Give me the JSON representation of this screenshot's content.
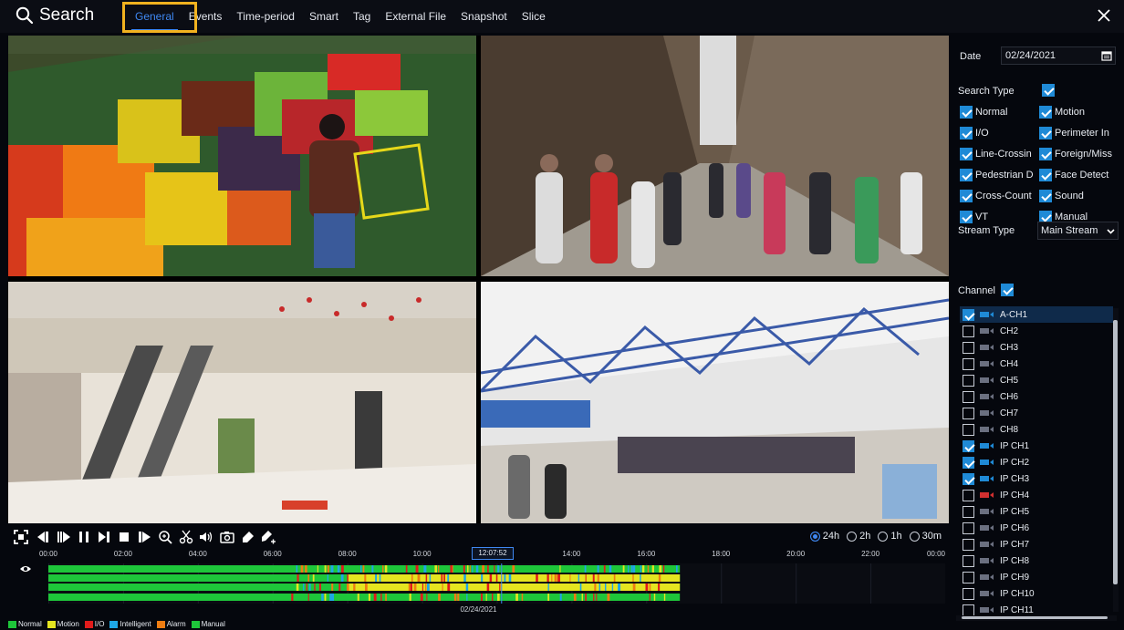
{
  "app": {
    "title": "Search",
    "tabs": [
      {
        "label": "General",
        "active": true
      },
      {
        "label": "Events",
        "active": false
      },
      {
        "label": "Time-period",
        "active": false
      },
      {
        "label": "Smart",
        "active": false
      },
      {
        "label": "Tag",
        "active": false
      },
      {
        "label": "External File",
        "active": false
      },
      {
        "label": "Snapshot",
        "active": false
      },
      {
        "label": "Slice",
        "active": false
      }
    ],
    "accent_color": "#3f88f2",
    "highlight_color": "#f2b21f",
    "close_icon": "close-icon"
  },
  "video_tiles": [
    {
      "scene": "grocery-produce"
    },
    {
      "scene": "pedestrian-street"
    },
    {
      "scene": "shopping-mall-escalator"
    },
    {
      "scene": "airport-terminal"
    }
  ],
  "playback": {
    "controls": [
      "fullscreen-icon",
      "rewind-icon",
      "step-forward-icon",
      "pause-icon",
      "next-frame-icon",
      "stop-icon",
      "fast-forward-icon",
      "zoom-icon",
      "clip-icon",
      "audio-icon",
      "snapshot-icon",
      "tag-icon",
      "add-tag-icon"
    ],
    "zoom_options": [
      {
        "label": "24h",
        "selected": true
      },
      {
        "label": "2h",
        "selected": false
      },
      {
        "label": "1h",
        "selected": false
      },
      {
        "label": "30m",
        "selected": false
      }
    ]
  },
  "timeline": {
    "ticks": [
      "00:00",
      "02:00",
      "04:00",
      "06:00",
      "08:00",
      "10:00",
      "12:00",
      "14:00",
      "16:00",
      "18:00",
      "20:00",
      "22:00",
      "00:00"
    ],
    "current_time": "12:07:52",
    "date": "02/24/2021",
    "recorded_until_hour": 16.9,
    "colors": {
      "normal": "#1ec63a",
      "motion": "#e5e520",
      "io": "#e01b1b",
      "intelligent": "#1ea7e6",
      "alarm": "#ef7d12",
      "manual": "#1ec63a"
    }
  },
  "legend": [
    {
      "label": "Normal",
      "color": "#1ec63a"
    },
    {
      "label": "Motion",
      "color": "#e5e520"
    },
    {
      "label": "I/O",
      "color": "#e01b1b"
    },
    {
      "label": "Intelligent",
      "color": "#1ea7e6"
    },
    {
      "label": "Alarm",
      "color": "#ef7d12"
    },
    {
      "label": "Manual",
      "color": "#1ec63a"
    }
  ],
  "panel": {
    "date_label": "Date",
    "date_value": "02/24/2021",
    "search_type_label": "Search Type",
    "search_types": [
      {
        "label": "Normal",
        "checked": true
      },
      {
        "label": "Motion",
        "checked": true
      },
      {
        "label": "I/O",
        "checked": true
      },
      {
        "label": "Perimeter In",
        "checked": true
      },
      {
        "label": "Line-Crossin",
        "checked": true
      },
      {
        "label": "Foreign/Miss",
        "checked": true
      },
      {
        "label": "Pedestrian D",
        "checked": true
      },
      {
        "label": "Face Detect",
        "checked": true
      },
      {
        "label": "Cross-Count",
        "checked": true
      },
      {
        "label": "Sound",
        "checked": true
      },
      {
        "label": "VT",
        "checked": true
      },
      {
        "label": "Manual",
        "checked": true
      }
    ],
    "stream_type_label": "Stream Type",
    "stream_type_value": "Main Stream",
    "channel_label": "Channel",
    "channels": [
      {
        "name": "A-CH1",
        "checked": true,
        "selected": true,
        "cam_color": "#1f8ad6"
      },
      {
        "name": "CH2",
        "checked": false,
        "selected": false,
        "cam_color": "#6b7080"
      },
      {
        "name": "CH3",
        "checked": false,
        "selected": false,
        "cam_color": "#6b7080"
      },
      {
        "name": "CH4",
        "checked": false,
        "selected": false,
        "cam_color": "#6b7080"
      },
      {
        "name": "CH5",
        "checked": false,
        "selected": false,
        "cam_color": "#6b7080"
      },
      {
        "name": "CH6",
        "checked": false,
        "selected": false,
        "cam_color": "#6b7080"
      },
      {
        "name": "CH7",
        "checked": false,
        "selected": false,
        "cam_color": "#6b7080"
      },
      {
        "name": "CH8",
        "checked": false,
        "selected": false,
        "cam_color": "#6b7080"
      },
      {
        "name": "IP CH1",
        "checked": true,
        "selected": false,
        "cam_color": "#1f8ad6"
      },
      {
        "name": "IP CH2",
        "checked": true,
        "selected": false,
        "cam_color": "#1f8ad6"
      },
      {
        "name": "IP CH3",
        "checked": true,
        "selected": false,
        "cam_color": "#1f8ad6"
      },
      {
        "name": "IP CH4",
        "checked": false,
        "selected": false,
        "cam_color": "#d23030"
      },
      {
        "name": "IP CH5",
        "checked": false,
        "selected": false,
        "cam_color": "#6b7080"
      },
      {
        "name": "IP CH6",
        "checked": false,
        "selected": false,
        "cam_color": "#6b7080"
      },
      {
        "name": "IP CH7",
        "checked": false,
        "selected": false,
        "cam_color": "#6b7080"
      },
      {
        "name": "IP CH8",
        "checked": false,
        "selected": false,
        "cam_color": "#6b7080"
      },
      {
        "name": "IP CH9",
        "checked": false,
        "selected": false,
        "cam_color": "#6b7080"
      },
      {
        "name": "IP CH10",
        "checked": false,
        "selected": false,
        "cam_color": "#6b7080"
      },
      {
        "name": "IP CH11",
        "checked": false,
        "selected": false,
        "cam_color": "#6b7080"
      }
    ]
  }
}
